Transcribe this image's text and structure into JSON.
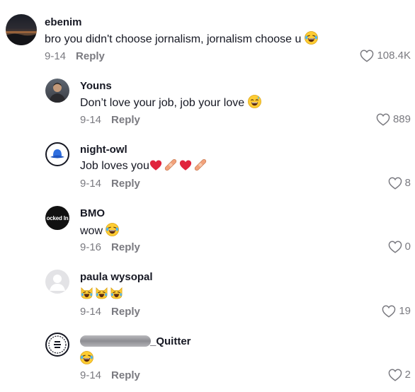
{
  "comments": [
    {
      "username": "ebenim",
      "text": "bro you didn't choose jornalism, jornalism choose u",
      "emoji": "laughing-tears",
      "date": "9-14",
      "reply": "Reply",
      "likes": "108.4K"
    },
    {
      "username": "Youns",
      "text": "Don’t love your job, job your love",
      "emoji": "sweat-smile",
      "date": "9-14",
      "reply": "Reply",
      "likes": "889"
    },
    {
      "username": "night-owl",
      "text": "Job loves you",
      "emoji": "hearts-bandages",
      "date": "9-14",
      "reply": "Reply",
      "likes": "8"
    },
    {
      "username": "BMO",
      "text": "wow",
      "emoji": "laughing-tears",
      "date": "9-16",
      "reply": "Reply",
      "likes": "0",
      "avatar_text": "ocked In"
    },
    {
      "username": "paula wysopal",
      "text": "",
      "emoji": "cat-tears-x3",
      "date": "9-14",
      "reply": "Reply",
      "likes": "19"
    },
    {
      "username": "_Quitter",
      "text": "",
      "emoji": "laughing-tears",
      "date": "9-14",
      "reply": "Reply",
      "likes": "2"
    }
  ],
  "colors": {
    "text": "#161823",
    "muted": "#7a7a80",
    "heart": "#e0243d",
    "bandage": "#f2a27b"
  }
}
